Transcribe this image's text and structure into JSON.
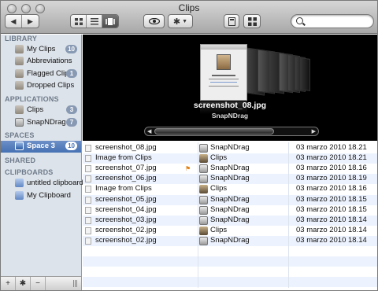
{
  "window": {
    "title": "Clips"
  },
  "toolbar": {
    "search_placeholder": "",
    "view_icons": [
      "grid-view-icon",
      "list-view-icon",
      "coverflow-view-icon"
    ],
    "selected_view": "coverflow"
  },
  "sidebar": {
    "sections": [
      {
        "title": "LIBRARY",
        "items": [
          {
            "label": "My Clips",
            "badge": "10",
            "icon": "clips-library-icon"
          },
          {
            "label": "Abbreviations",
            "badge": "",
            "icon": "abbreviations-icon"
          },
          {
            "label": "Flagged Clips",
            "badge": "1",
            "icon": "flagged-clips-icon"
          },
          {
            "label": "Dropped Clips",
            "badge": "",
            "icon": "dropped-clips-icon"
          }
        ]
      },
      {
        "title": "APPLICATIONS",
        "items": [
          {
            "label": "Clips",
            "badge": "3",
            "icon": "clips-app-icon"
          },
          {
            "label": "SnapNDrag",
            "badge": "7",
            "icon": "snapndrag-app-icon"
          }
        ]
      },
      {
        "title": "SPACES",
        "items": [
          {
            "label": "Space 3",
            "badge": "10",
            "icon": "space-icon",
            "selected": true
          }
        ]
      },
      {
        "title": "SHARED",
        "items": []
      },
      {
        "title": "CLIPBOARDS",
        "items": [
          {
            "label": "untitled clipboard",
            "badge": "",
            "icon": "clipboard-icon"
          },
          {
            "label": "My Clipboard",
            "badge": "",
            "icon": "clipboard-icon"
          }
        ]
      }
    ],
    "footer": {
      "add": "+",
      "gear": "✱",
      "remove": "−"
    }
  },
  "coverflow": {
    "selected_name": "screenshot_08.jpg",
    "selected_app": "SnapNDrag"
  },
  "clips": [
    {
      "name": "screenshot_08.jpg",
      "app": "SnapNDrag",
      "date": "03 marzo 2010 18.21",
      "flag": false
    },
    {
      "name": "Image from Clips",
      "app": "Clips",
      "date": "03 marzo 2010 18.21",
      "flag": false
    },
    {
      "name": "screenshot_07.jpg",
      "app": "SnapNDrag",
      "date": "03 marzo 2010 18.16",
      "flag": true
    },
    {
      "name": "screenshot_06.jpg",
      "app": "SnapNDrag",
      "date": "03 marzo 2010 18.19",
      "flag": false
    },
    {
      "name": "Image from Clips",
      "app": "Clips",
      "date": "03 marzo 2010 18.16",
      "flag": false
    },
    {
      "name": "screenshot_05.jpg",
      "app": "SnapNDrag",
      "date": "03 marzo 2010 18.15",
      "flag": false
    },
    {
      "name": "screenshot_04.jpg",
      "app": "SnapNDrag",
      "date": "03 marzo 2010 18.15",
      "flag": false
    },
    {
      "name": "screenshot_03.jpg",
      "app": "SnapNDrag",
      "date": "03 marzo 2010 18.14",
      "flag": false
    },
    {
      "name": "screenshot_02.jpg",
      "app": "Clips",
      "date": "03 marzo 2010 18.14",
      "flag": false
    },
    {
      "name": "screenshot_02.jpg",
      "app": "SnapNDrag",
      "date": "03 marzo 2010 18.14",
      "flag": false
    }
  ],
  "colors": {
    "selection": "#4571b3",
    "badge": "#8899b3",
    "sidebar_bg": "#dde3ea",
    "alt_row": "#edf3fe"
  }
}
